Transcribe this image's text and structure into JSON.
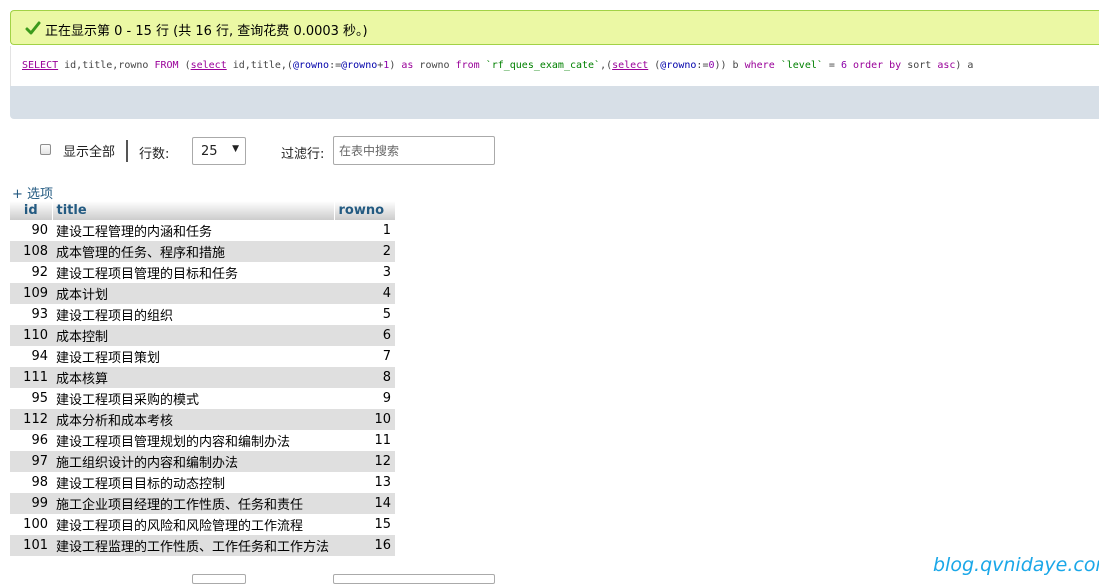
{
  "success": {
    "message": "正在显示第 0 - 15 行 (共 16 行, 查询花费 0.0003 秒。)",
    "icon": "check-icon"
  },
  "sql": {
    "parts": [
      {
        "t": "SELECT",
        "c": "kwu"
      },
      {
        "t": " id,title,rowno ",
        "c": ""
      },
      {
        "t": "FROM",
        "c": "kw"
      },
      {
        "t": " (",
        "c": ""
      },
      {
        "t": "select",
        "c": "kwu"
      },
      {
        "t": " id,title,(",
        "c": ""
      },
      {
        "t": "@rowno",
        "c": "var"
      },
      {
        "t": ":=",
        "c": ""
      },
      {
        "t": "@rowno",
        "c": "var"
      },
      {
        "t": "+",
        "c": ""
      },
      {
        "t": "1",
        "c": "num"
      },
      {
        "t": ") ",
        "c": ""
      },
      {
        "t": "as",
        "c": "kw"
      },
      {
        "t": " rowno ",
        "c": ""
      },
      {
        "t": "from",
        "c": "kw"
      },
      {
        "t": " ",
        "c": ""
      },
      {
        "t": "`rf_ques_exam_cate`",
        "c": "str"
      },
      {
        "t": ",(",
        "c": ""
      },
      {
        "t": "select",
        "c": "kwu"
      },
      {
        "t": " (",
        "c": ""
      },
      {
        "t": "@rowno",
        "c": "var"
      },
      {
        "t": ":=",
        "c": ""
      },
      {
        "t": "0",
        "c": "num"
      },
      {
        "t": ")) b ",
        "c": ""
      },
      {
        "t": "where",
        "c": "kw"
      },
      {
        "t": " ",
        "c": ""
      },
      {
        "t": "`level`",
        "c": "str"
      },
      {
        "t": " = ",
        "c": ""
      },
      {
        "t": "6",
        "c": "num"
      },
      {
        "t": " ",
        "c": ""
      },
      {
        "t": "order by",
        "c": "kw"
      },
      {
        "t": " sort ",
        "c": ""
      },
      {
        "t": "asc",
        "c": "kw"
      },
      {
        "t": ") a",
        "c": ""
      }
    ]
  },
  "nav": {
    "show_all_label": "显示全部",
    "show_all_checked": false,
    "rows_label": "行数:",
    "rows_value": "25",
    "filter_label": "过滤行:",
    "filter_placeholder": "在表中搜索"
  },
  "options_link": "+ 选项",
  "table": {
    "columns": [
      "id",
      "title",
      "rowno"
    ],
    "rows": [
      {
        "id": "90",
        "title": "建设工程管理的内涵和任务",
        "rowno": "1"
      },
      {
        "id": "108",
        "title": "成本管理的任务、程序和措施",
        "rowno": "2"
      },
      {
        "id": "92",
        "title": "建设工程项目管理的目标和任务",
        "rowno": "3"
      },
      {
        "id": "109",
        "title": "成本计划",
        "rowno": "4"
      },
      {
        "id": "93",
        "title": "建设工程项目的组织",
        "rowno": "5"
      },
      {
        "id": "110",
        "title": "成本控制",
        "rowno": "6"
      },
      {
        "id": "94",
        "title": "建设工程项目策划",
        "rowno": "7"
      },
      {
        "id": "111",
        "title": "成本核算",
        "rowno": "8"
      },
      {
        "id": "95",
        "title": "建设工程项目采购的模式",
        "rowno": "9"
      },
      {
        "id": "112",
        "title": "成本分析和成本考核",
        "rowno": "10"
      },
      {
        "id": "96",
        "title": "建设工程项目管理规划的内容和编制办法",
        "rowno": "11"
      },
      {
        "id": "97",
        "title": "施工组织设计的内容和编制办法",
        "rowno": "12"
      },
      {
        "id": "98",
        "title": "建设工程项目目标的动态控制",
        "rowno": "13"
      },
      {
        "id": "99",
        "title": "施工企业项目经理的工作性质、任务和责任",
        "rowno": "14"
      },
      {
        "id": "100",
        "title": "建设工程项目的风险和风险管理的工作流程",
        "rowno": "15"
      },
      {
        "id": "101",
        "title": "建设工程监理的工作性质、工作任务和工作方法",
        "rowno": "16"
      }
    ]
  },
  "watermark": "blog.qvnidaye.com",
  "colors": {
    "success_bg": "#ebf8a4",
    "success_border": "#a2d246",
    "tools_bg": "#d7dfe7",
    "link": "#235a81",
    "row_alt": "#dfdfdf",
    "watermark": "#1aa7e8"
  }
}
